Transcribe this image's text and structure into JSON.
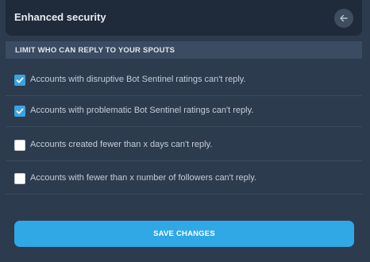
{
  "header": {
    "title": "Enhanced security",
    "back_icon": "arrow-left-icon"
  },
  "section": {
    "title": "LIMIT WHO CAN REPLY TO YOUR SPOUTS"
  },
  "options": [
    {
      "label": "Accounts with disruptive Bot Sentinel ratings can't reply.",
      "checked": true
    },
    {
      "label": "Accounts with problematic Bot Sentinel ratings can't reply.",
      "checked": true
    },
    {
      "label": "Accounts created fewer than x days can't reply.",
      "checked": false
    },
    {
      "label": "Accounts with fewer than x number of followers can't reply.",
      "checked": false
    }
  ],
  "save_button": {
    "label": "SAVE CHANGES"
  },
  "colors": {
    "accent": "#30a8e6",
    "checkbox_checked": "#3aa2e0",
    "background": "#2d3b4f",
    "header_bg": "#1f2a3a"
  }
}
